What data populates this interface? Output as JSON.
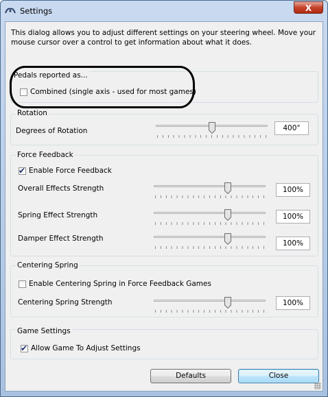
{
  "window": {
    "title": "Settings",
    "close_label": "X"
  },
  "intro_text": "This dialog allows you to adjust different settings on your steering wheel.  Move your mouse cursor over a control to get information about what it does.",
  "pedals": {
    "group_label": "Pedals reported as...",
    "combined": {
      "label": "Combined (single axis - used for most games)",
      "checked": false
    }
  },
  "rotation": {
    "group_label": "Rotation",
    "degrees": {
      "label": "Degrees of Rotation",
      "value": "400°",
      "level": 0.5
    }
  },
  "force_feedback": {
    "group_label": "Force Feedback",
    "enable": {
      "label": "Enable Force Feedback",
      "checked": true
    },
    "overall": {
      "label": "Overall Effects Strength",
      "value": "100%",
      "level": 0.67
    },
    "spring": {
      "label": "Spring Effect Strength",
      "value": "100%",
      "level": 0.67
    },
    "damper": {
      "label": "Damper Effect Strength",
      "value": "100%",
      "level": 0.67
    }
  },
  "centering": {
    "group_label": "Centering Spring",
    "enable": {
      "label": "Enable Centering Spring in Force Feedback Games",
      "checked": false
    },
    "strength": {
      "label": "Centering Spring Strength",
      "value": "100%",
      "level": 0.67
    }
  },
  "game_settings": {
    "group_label": "Game Settings",
    "allow": {
      "label": "Allow Game To Adjust Settings",
      "checked": true
    }
  },
  "buttons": {
    "defaults": "Defaults",
    "close": "Close"
  },
  "colors": {
    "title_gradient": "#b9cfea",
    "close_button": "#c7432c",
    "dialog_bg": "#f0f0f0",
    "annotation": "#000000"
  },
  "icons": {
    "app": "steering-wheel-icon",
    "close": "close-icon",
    "check": "check-icon"
  }
}
